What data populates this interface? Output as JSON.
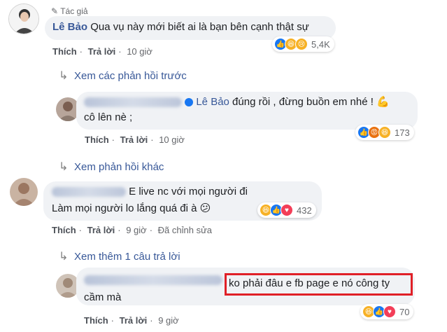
{
  "c1": {
    "badge": "Tác giả",
    "author": "Lê Bảo",
    "text": "Qua vụ này mới biết ai là bạn bên cạnh thật sự",
    "like": "Thích",
    "reply": "Trả lời",
    "time": "10 giờ",
    "reactions": {
      "icons": [
        "like-icon",
        "haha-icon",
        "sad-icon"
      ],
      "count": "5,4K"
    }
  },
  "prev_replies": "Xem các phản hồi trước",
  "r1": {
    "mention": "Lê Bảo",
    "text": " đúng rồi , đừng buồn em nhé ! 💪",
    "text2": "cô lên nè ;",
    "like": "Thích",
    "reply": "Trả lời",
    "time": "10 giờ",
    "reactions": {
      "icons": [
        "like-icon",
        "angry-icon",
        "haha-icon"
      ],
      "count": "173"
    }
  },
  "other_replies": "Xem phản hồi khác",
  "c2": {
    "text": "E live nc với mọi người đi",
    "text2": "Làm mọi người lo lắng quá đi à 😕",
    "like": "Thích",
    "reply": "Trả lời",
    "time": "9 giờ",
    "edited": "Đã chỉnh sửa",
    "reactions": {
      "icons": [
        "haha-icon",
        "like-icon",
        "love-icon"
      ],
      "count": "432"
    }
  },
  "more_replies": "Xem thêm 1 câu trả lời",
  "r2": {
    "text": "ko phải đâu e fb page e nó công ty",
    "text2": "cầm mà",
    "like": "Thích",
    "reply": "Trả lời",
    "time": "9 giờ",
    "reactions": {
      "icons": [
        "haha-icon",
        "like-icon",
        "love-icon"
      ],
      "count": "70"
    }
  },
  "colors": {
    "link": "#385898",
    "bubble": "#f0f2f5",
    "highlight": "#e02027",
    "like": "#1877f2"
  }
}
